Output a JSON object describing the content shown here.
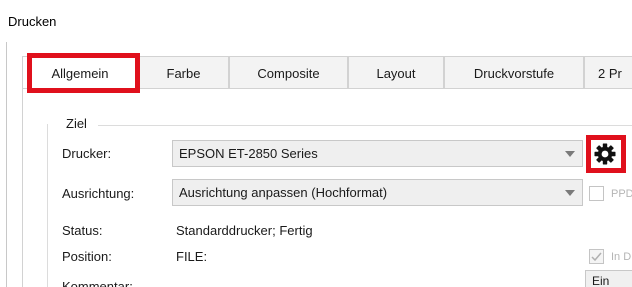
{
  "window": {
    "title": "Drucken"
  },
  "tabs": [
    {
      "label": "Allgemein",
      "active": true
    },
    {
      "label": "Farbe",
      "active": false
    },
    {
      "label": "Composite",
      "active": false
    },
    {
      "label": "Layout",
      "active": false
    },
    {
      "label": "Druckvorstufe",
      "active": false
    },
    {
      "label": "2 Pr",
      "active": false
    }
  ],
  "ziel": {
    "title": "Ziel",
    "drucker_label": "Drucker:",
    "drucker_value": "EPSON ET-2850 Series",
    "ausrichtung_label": "Ausrichtung:",
    "ausrichtung_value": "Ausrichtung anpassen (Hochformat)",
    "ppd_label": "PPD",
    "status_label": "Status:",
    "status_value": "Standarddrucker; Fertig",
    "position_label": "Position:",
    "position_value": "FILE:",
    "in_label": "In D",
    "kommentar_label": "Kommentar:",
    "bottom_button_label": "Ein"
  },
  "icons": {
    "settings": "gear-icon",
    "dropdown": "chevron-down-icon"
  },
  "colors": {
    "highlight": "#e0101c"
  }
}
